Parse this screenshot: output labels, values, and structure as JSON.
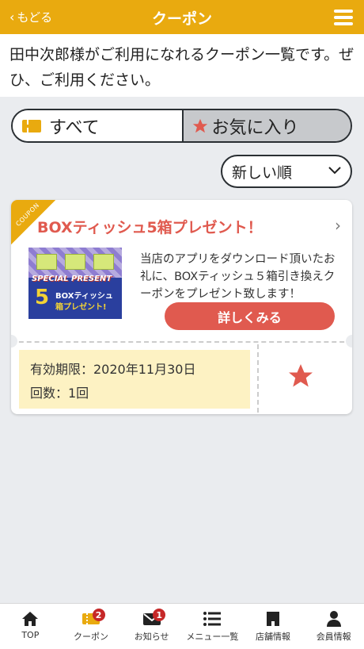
{
  "header": {
    "back_label": "もどる",
    "title": "クーポン"
  },
  "intro": {
    "text": "田中次郎様がご利用になれるクーポン一覧です。ぜひ、ご利用ください。"
  },
  "tabs": [
    {
      "label": "すべて",
      "icon": "ticket-icon"
    },
    {
      "label": "お気に入り",
      "icon": "star-icon"
    }
  ],
  "sort": {
    "selected": "新しい順"
  },
  "coupon": {
    "corner_label": "COUPON",
    "title": "BOXティッシュ5箱プレゼント！",
    "image": {
      "line1": "SPECIAL PRESENT",
      "number": "5",
      "line2": "BOXティッシュ",
      "line3": "箱プレゼント!"
    },
    "description": "当店のアプリをダウンロード頂いたお礼に、BOXティッシュ５箱引き換えクーポンをプレゼント致します！",
    "detail_button": "詳しくみる",
    "expiry": "有効期限：2020年11月30日",
    "count": "回数：1回"
  },
  "tabbar": [
    {
      "label": "TOP",
      "icon": "home-icon",
      "badge": null
    },
    {
      "label": "クーポン",
      "icon": "coupon-icon",
      "badge": "2"
    },
    {
      "label": "お知らせ",
      "icon": "mail-icon",
      "badge": "1"
    },
    {
      "label": "メニュー一覧",
      "icon": "list-icon",
      "badge": null
    },
    {
      "label": "店舗情報",
      "icon": "shop-icon",
      "badge": null
    },
    {
      "label": "会員情報",
      "icon": "user-icon",
      "badge": null
    }
  ],
  "colors": {
    "accent": "#e9aa0f",
    "primary_red": "#e05a4f",
    "badge_red": "#c62828",
    "info_bg": "#fdf2c3"
  }
}
